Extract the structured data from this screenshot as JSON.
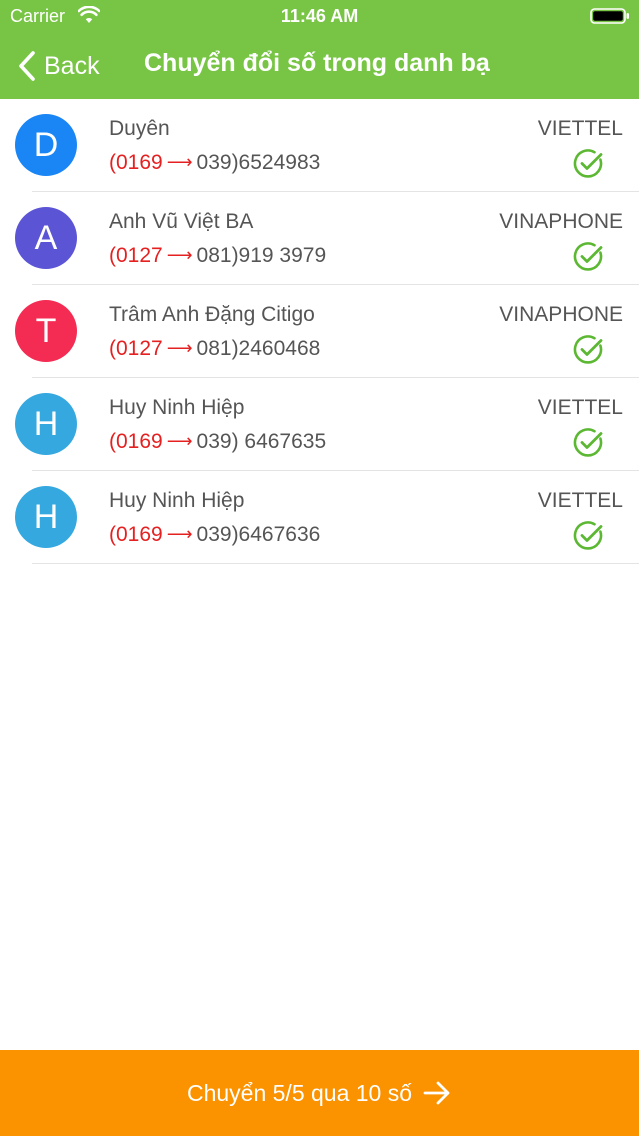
{
  "status_bar": {
    "carrier": "Carrier",
    "time": "11:46 AM"
  },
  "nav": {
    "back_label": "Back",
    "title": "Chuyển đổi số trong danh bạ"
  },
  "colors": {
    "header": "#78c545",
    "bottom_bar": "#fb9200",
    "old_prefix": "#e52020",
    "check": "#5cb833"
  },
  "contacts": [
    {
      "initial": "D",
      "avatar_color": "#1a86f5",
      "name": "Duyên",
      "old_prefix": "(0169",
      "new_number": "039)6524983",
      "carrier": "VIETTEL",
      "icon": "check-circle-icon"
    },
    {
      "initial": "A",
      "avatar_color": "#5b55d6",
      "name": "Anh Vũ Việt BA",
      "old_prefix": "(0127",
      "new_number": "081)919 3979",
      "carrier": "VINAPHONE",
      "icon": "check-circle-icon"
    },
    {
      "initial": "T",
      "avatar_color": "#f42b52",
      "name": "Trâm Anh Đặng Citigo",
      "old_prefix": "(0127",
      "new_number": "081)2460468",
      "carrier": "VINAPHONE",
      "icon": "check-circle-icon"
    },
    {
      "initial": "H",
      "avatar_color": "#35a8e0",
      "name": "Huy Ninh Hiệp",
      "old_prefix": "(0169",
      "new_number": "039) 6467635",
      "carrier": "VIETTEL",
      "icon": "check-circle-icon"
    },
    {
      "initial": "H",
      "avatar_color": "#35a8e0",
      "name": "Huy Ninh Hiệp",
      "old_prefix": "(0169",
      "new_number": "039)6467636",
      "carrier": "VIETTEL",
      "icon": "check-circle-icon"
    }
  ],
  "bottom": {
    "label": "Chuyển 5/5 qua 10 số",
    "icon": "arrow-right-icon"
  }
}
